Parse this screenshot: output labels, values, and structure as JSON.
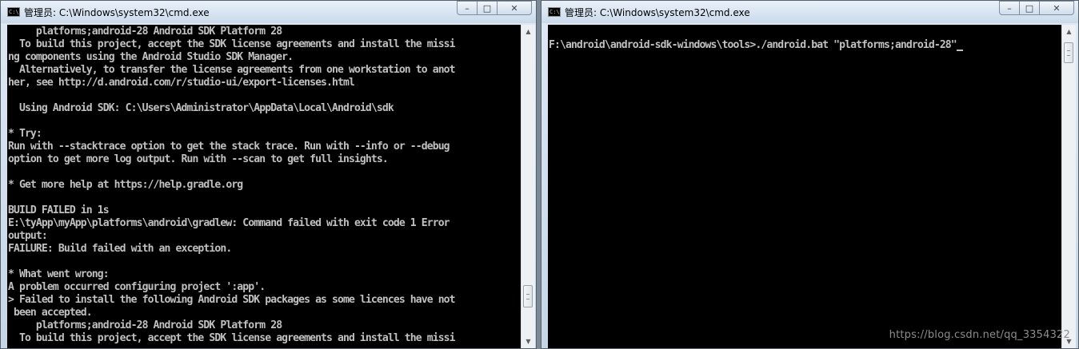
{
  "left_window": {
    "title": "管理员: C:\\Windows\\system32\\cmd.exe",
    "app_icon_text": "C:\\",
    "console_lines": [
      "     platforms;android-28 Android SDK Platform 28",
      "  To build this project, accept the SDK license agreements and install the missi",
      "ng components using the Android Studio SDK Manager.",
      "  Alternatively, to transfer the license agreements from one workstation to anot",
      "her, see http://d.android.com/r/studio-ui/export-licenses.html",
      "",
      "  Using Android SDK: C:\\Users\\Administrator\\AppData\\Local\\Android\\sdk",
      "",
      "* Try:",
      "Run with --stacktrace option to get the stack trace. Run with --info or --debug",
      "option to get more log output. Run with --scan to get full insights.",
      "",
      "* Get more help at https://help.gradle.org",
      "",
      "BUILD FAILED in 1s",
      "E:\\tyApp\\myApp\\platforms\\android\\gradlew: Command failed with exit code 1 Error",
      "output:",
      "FAILURE: Build failed with an exception.",
      "",
      "* What went wrong:",
      "A problem occurred configuring project ':app'.",
      "> Failed to install the following Android SDK packages as some licences have not",
      " been accepted.",
      "     platforms;android-28 Android SDK Platform 28",
      "  To build this project, accept the SDK license agreements and install the missi"
    ]
  },
  "right_window": {
    "title": "管理员: C:\\Windows\\system32\\cmd.exe",
    "app_icon_text": "C:\\",
    "prompt_line": "F:\\android\\android-sdk-windows\\tools>./android.bat \"platforms;android-28\""
  },
  "caption_buttons": {
    "minimize_glyph": "–",
    "maximize_glyph": "□",
    "close_glyph": "✕"
  },
  "scroll_arrows": {
    "up": "▲",
    "down": "▼"
  },
  "watermark": "https://blog.csdn.net/qq_3354322",
  "colors": {
    "console_bg": "#000000",
    "console_text": "#c0c0c0",
    "titlebar": "#d6e3f1"
  }
}
